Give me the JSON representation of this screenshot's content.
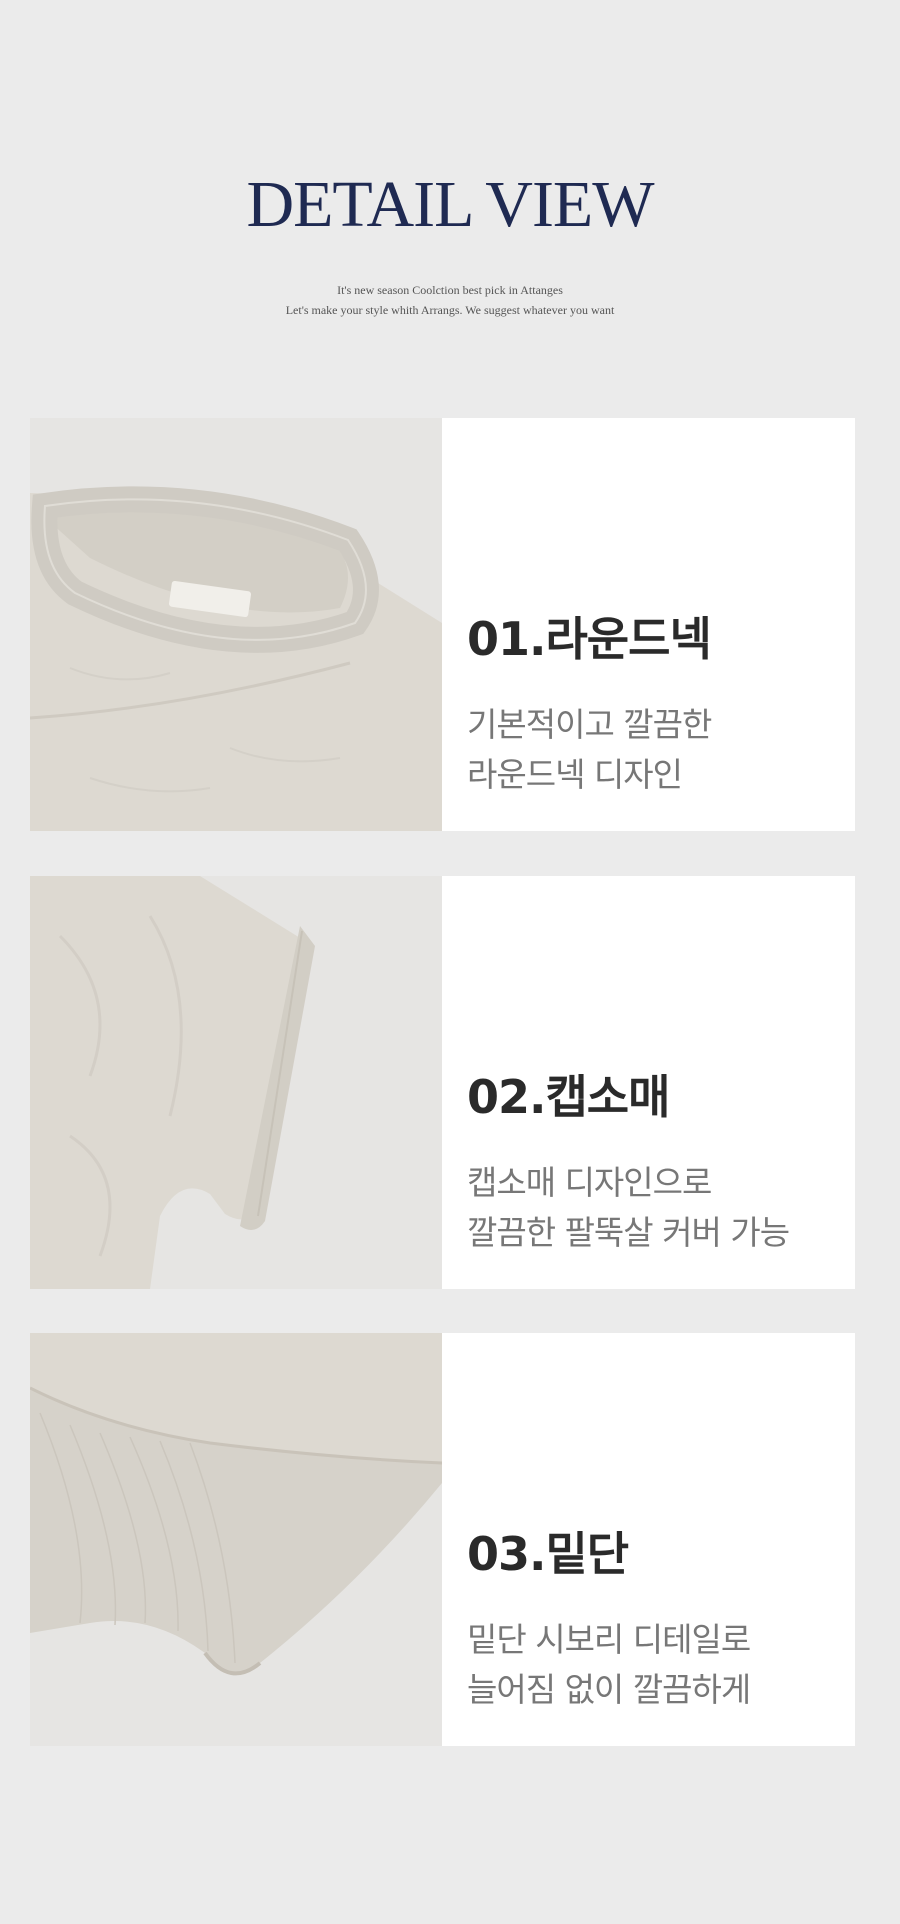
{
  "header": {
    "title": "DETAIL VIEW",
    "subtitle_line1": "It's new season Coolction best pick in Attanges",
    "subtitle_line2": "Let's make your style whith Arrangs. We suggest whatever you want"
  },
  "details": [
    {
      "title": "01.라운드넥",
      "desc_line1": "기본적이고 깔끔한",
      "desc_line2": "라운드넥 디자인"
    },
    {
      "title": "02.캡소매",
      "desc_line1": "캡소매 디자인으로",
      "desc_line2": "깔끔한 팔뚝살 커버 가능"
    },
    {
      "title": "03.밑단",
      "desc_line1": "밑단 시보리 디테일로",
      "desc_line2": "늘어짐 없이 깔끔하게"
    }
  ],
  "colors": {
    "page_background": "#ebebeb",
    "title_navy": "#1f2a52",
    "fabric_beige": "#dcd8d0",
    "card_white": "#ffffff"
  }
}
